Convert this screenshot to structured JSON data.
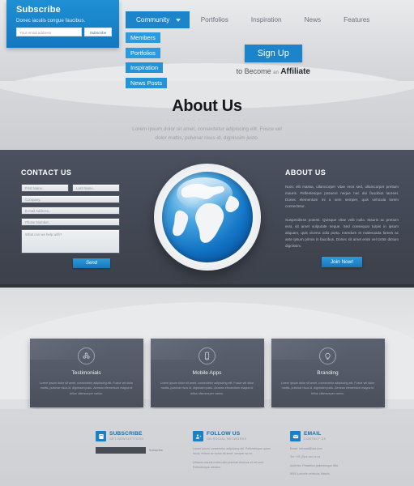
{
  "subscribe_widget": {
    "title": "Subscribe",
    "tagline": "Donec iaculis congue faucibus.",
    "input_placeholder": "Your email address",
    "button_label": "Subscribe"
  },
  "nav": {
    "items": [
      {
        "label": "Community",
        "active": true,
        "has_dropdown": true
      },
      {
        "label": "Portfolios",
        "active": false
      },
      {
        "label": "Inspiration",
        "active": false
      },
      {
        "label": "News",
        "active": false
      },
      {
        "label": "Features",
        "active": false
      }
    ],
    "dropdown": [
      "Members",
      "Portfolios",
      "Inspiration",
      "News Posts"
    ]
  },
  "signup": {
    "button_label": "Sign Up",
    "caption_before": "to Become",
    "caption_small": "an",
    "caption_strong": "Affiliate"
  },
  "hero": {
    "title": "About Us",
    "divider": "· · · · · · · · · · · · · · · ·",
    "subtitle_line1": "Lorem ipsum dolor sit amet, consectetur adipiscing elit. Fusce vel",
    "subtitle_line2": "dolor mattis, pulvinar risus id, dignissim justo."
  },
  "contact": {
    "title": "CONTACT US",
    "first_name_placeholder": "First Name..",
    "last_name_placeholder": "Last Name..",
    "company_placeholder": "Company..",
    "email_placeholder": "E-mail Address..",
    "phone_placeholder": "Phone Number..",
    "message_placeholder": "What can we help with?",
    "send_label": "Send"
  },
  "globe": {
    "icon": "globe-image"
  },
  "about": {
    "title": "ABOUT US",
    "paragraph1": "Nunc elit massa, ullamcorper vitae eros sed, ullamcorper pretium mauris. Pellentesque posuere neque nec dui faucibus laoreet. Donec elementum mi a sem semper, quis vehicula lorem consectetur.",
    "paragraph2": "Suspendisse potenti. Quisque vitae velit nulla. Mauris ac pretium erat, sit amet vulputate neque. Sed consequat turpis in ipsum aliquam, quis viverra odio porta. Interdum et malesuada fames ac ante ipsum primis in faucibus. Donec sit amet enim vel tortor dictum dignissim.",
    "button_label": "Join Now!"
  },
  "cards": [
    {
      "icon": "people-icon",
      "title": "Testimonials",
      "text": "Lorem ipsum dolor sit amet, consectetur adipiscing elit. Fusce vel dolor mattis, pulvinar risus id, dignissim justo. Aenean elementum magna id tellus ullamcorper varius."
    },
    {
      "icon": "mobile-phone-icon",
      "title": "Mobile Apps",
      "text": "Lorem ipsum dolor sit amet, consectetur adipiscing elit. Fusce vel dolor mattis, pulvinar risus id, dignissim justo. Aenean elementum magna id tellus ullamcorper varius."
    },
    {
      "icon": "lightbulb-icon",
      "title": "Branding",
      "text": "Lorem ipsum dolor sit amet, consectetur adipiscing elit. Fusce vel dolor mattis, pulvinar risus id, dignissim justo. Aenean elementum magna id tellus ullamcorper varius."
    }
  ],
  "footer": {
    "subscribe": {
      "icon": "newsletter-icon",
      "title": "SUBSCRIBE",
      "subtitle": "GET NEWSLETTERS",
      "button_label": "Subscribe"
    },
    "follow": {
      "icon": "social-users-icon",
      "title": "FOLLOW US",
      "subtitle": "ON SOCIAL NETWORKS",
      "text1": "Lorem ipsum consectetur adipiscing elit. Pellentesque quam lacus, finibus ac luctus sit amet, semper ac mi.",
      "text2": "Utharus mauris mollis odio pulvinar rhoncus et vel sem. Pellentesque ultricies."
    },
    "email": {
      "icon": "mail-icon",
      "title": "EMAIL",
      "subtitle": "CONTACT US",
      "line1": "Email: infomail@dot.com",
      "line2": "Tel: +31 (0)xx xxx xx xx",
      "line3": "Address: Phasellus pellentesque 88a",
      "line4": "6000 Lobortis vehicula, Mauris"
    }
  },
  "colors": {
    "accent": "#1b84ca",
    "dark": "#434855",
    "light": "#e4e5e7"
  }
}
